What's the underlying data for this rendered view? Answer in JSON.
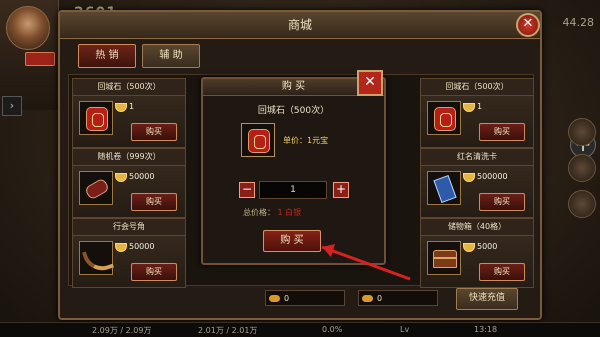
{
  "hud": {
    "score": "2601",
    "right_number": "44.28",
    "status": {
      "hp": "2.09万 / 2.09万",
      "mp": "2.01万 / 2.01万",
      "percent": "0.0%",
      "lv": "Lv",
      "time": "13:18"
    }
  },
  "shop": {
    "title": "商城",
    "tabs": [
      {
        "label": "热 销"
      },
      {
        "label": "辅 助"
      }
    ],
    "items": [
      {
        "name": "回城石（500次）",
        "price": "1",
        "buy": "购买"
      },
      {
        "name": "随机卷（999次）",
        "price": "50000",
        "buy": "购买"
      },
      {
        "name": "行会号角",
        "price": "50000",
        "buy": "购买"
      },
      {
        "name": "回城石（500次）",
        "price": "1",
        "buy": "购买"
      },
      {
        "name": "红名清洗卡",
        "price": "500000",
        "buy": "购买"
      },
      {
        "name": "储物箱（40格）",
        "price": "5000",
        "buy": "购买"
      }
    ],
    "balances": [
      "0",
      "0"
    ],
    "recharge": "快速充值"
  },
  "dialog": {
    "title": "购 买",
    "item_name": "回城石（500次）",
    "unit_price": "单价：1元宝",
    "quantity": "1",
    "total_label": "总价格：",
    "total_value": "1 白银",
    "confirm": "购 买"
  },
  "colors": {
    "accent_red": "#b5261a",
    "gold": "#f3d357",
    "frame": "#7b5c3a",
    "arrow": "#d9221f"
  }
}
